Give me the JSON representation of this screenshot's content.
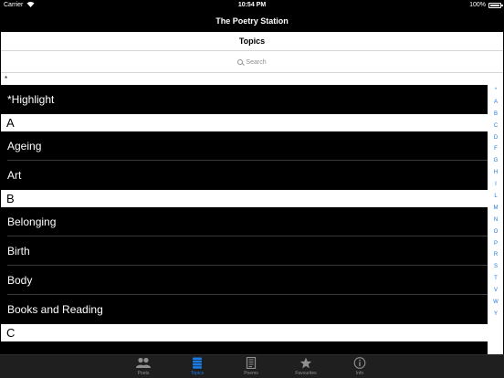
{
  "status": {
    "carrier": "Carrier",
    "time": "10:54 PM",
    "battery": "100%"
  },
  "nav": {
    "title": "The Poetry Station"
  },
  "page": {
    "title": "Topics"
  },
  "search": {
    "placeholder": "Search"
  },
  "list": {
    "top_marker": "*",
    "rows": [
      {
        "type": "row",
        "label": "*Highlight"
      },
      {
        "type": "header",
        "label": "A"
      },
      {
        "type": "row",
        "label": "Ageing"
      },
      {
        "type": "row",
        "label": "Art"
      },
      {
        "type": "header",
        "label": "B"
      },
      {
        "type": "row",
        "label": "Belonging"
      },
      {
        "type": "row",
        "label": "Birth"
      },
      {
        "type": "row",
        "label": "Body"
      },
      {
        "type": "row",
        "label": "Books and Reading"
      },
      {
        "type": "header",
        "label": "C"
      }
    ]
  },
  "index": [
    "*",
    "A",
    "B",
    "C",
    "D",
    "F",
    "G",
    "H",
    "I",
    "L",
    "M",
    "N",
    "O",
    "P",
    "R",
    "S",
    "T",
    "V",
    "W",
    "Y"
  ],
  "tabs": [
    {
      "label": "Poets",
      "icon": "poets-icon",
      "active": false
    },
    {
      "label": "Topics",
      "icon": "topics-icon",
      "active": true
    },
    {
      "label": "Poems",
      "icon": "poems-icon",
      "active": false
    },
    {
      "label": "Favourites",
      "icon": "favourites-icon",
      "active": false
    },
    {
      "label": "Info",
      "icon": "info-icon",
      "active": false
    }
  ],
  "colors": {
    "accent": "#1a7ae6",
    "row_background": "#000000",
    "tab_bar": "#1f1f1f"
  }
}
